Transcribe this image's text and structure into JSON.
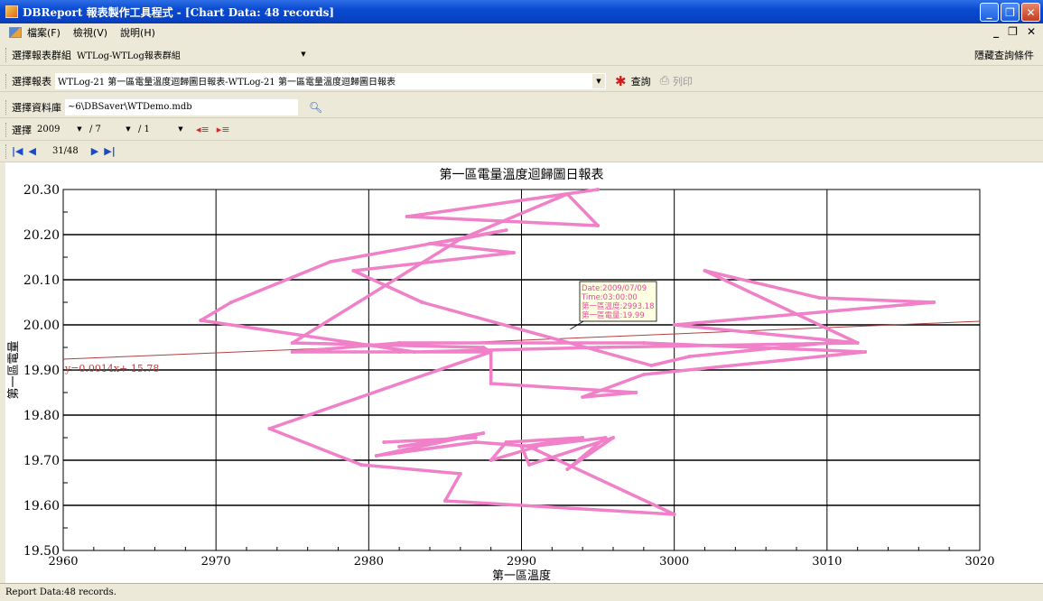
{
  "window": {
    "title": "DBReport 報表製作工具程式 - [Chart Data: 48 records]"
  },
  "menu": {
    "items": [
      "檔案(F)",
      "檢視(V)",
      "說明(H)"
    ]
  },
  "toolbar": {
    "group_label": "選擇報表群組",
    "group_value": "WTLog-WTLog報表群組",
    "hide_query": "隱藏查詢條件",
    "report_label": "選擇報表",
    "report_value": "WTLog-21 第一區電量溫度迴歸圖日報表-WTLog-21 第一區電量溫度迴歸圖日報表",
    "query_label": "查詢",
    "print_label": "列印",
    "db_label": "選擇資料庫",
    "db_value": "~6\\DBSaver\\WTDemo.mdb",
    "select_label": "選擇",
    "year": "2009",
    "month": "/ 7",
    "day": "/ 1",
    "page_indicator": "31/48"
  },
  "status": {
    "text": "Report Data:48 records."
  },
  "chart_data": {
    "type": "scatter",
    "title": "第一區電量溫度迴歸圖日報表",
    "xlabel": "第一區溫度",
    "ylabel": "第一區電量",
    "xlim": [
      2960,
      3020
    ],
    "ylim": [
      19.5,
      20.3
    ],
    "x_ticks": [
      "2960",
      "2970",
      "2980",
      "2990",
      "3000",
      "3010",
      "3020"
    ],
    "y_ticks": [
      "19.50",
      "19.60",
      "19.70",
      "19.80",
      "19.90",
      "20.00",
      "20.10",
      "20.20",
      "20.30"
    ],
    "grid": true,
    "series": [
      {
        "color": "#f080c8",
        "points": [
          [
            2995,
            20.3
          ],
          [
            2982.5,
            20.24
          ],
          [
            2995,
            20.22
          ],
          [
            2993,
            20.29
          ],
          [
            2986,
            20.19
          ],
          [
            2989,
            20.21
          ],
          [
            2977.5,
            20.14
          ],
          [
            2971,
            20.05
          ],
          [
            2969,
            20.01
          ],
          [
            2983,
            19.94
          ],
          [
            2995,
            19.95
          ],
          [
            3012,
            19.96
          ],
          [
            3002,
            20.12
          ],
          [
            3009.5,
            20.06
          ],
          [
            3017,
            20.05
          ],
          [
            3000,
            20.0
          ],
          [
            3012,
            19.96
          ],
          [
            3010,
            19.96
          ],
          [
            3001,
            19.93
          ],
          [
            2998.5,
            19.91
          ],
          [
            2983.5,
            20.05
          ],
          [
            2979,
            20.12
          ],
          [
            2989.5,
            20.16
          ],
          [
            2984,
            20.18
          ],
          [
            2986,
            20.19
          ],
          [
            2975,
            19.96
          ],
          [
            2987.5,
            19.95
          ],
          [
            2988,
            19.94
          ],
          [
            2982,
            19.94
          ],
          [
            2975,
            19.94
          ],
          [
            2982,
            19.96
          ],
          [
            2998,
            19.96
          ],
          [
            3012.5,
            19.94
          ],
          [
            2998,
            19.89
          ],
          [
            2994,
            19.84
          ],
          [
            2997.5,
            19.85
          ],
          [
            2988,
            19.87
          ],
          [
            2988,
            19.94
          ],
          [
            2973.5,
            19.77
          ],
          [
            2979.5,
            19.69
          ],
          [
            2986,
            19.67
          ],
          [
            2985,
            19.61
          ],
          [
            3000,
            19.58
          ],
          [
            2990.5,
            19.73
          ],
          [
            2995.5,
            19.75
          ],
          [
            2993,
            19.68
          ],
          [
            2996,
            19.75
          ],
          [
            2990.5,
            19.69
          ],
          [
            2990,
            19.73
          ],
          [
            2994,
            19.75
          ],
          [
            2989,
            19.74
          ],
          [
            2988,
            19.7
          ],
          [
            2991,
            19.73
          ],
          [
            2987,
            19.74
          ],
          [
            2980.5,
            19.71
          ],
          [
            2987.5,
            19.76
          ],
          [
            2982,
            19.73
          ],
          [
            2986,
            19.75
          ],
          [
            2987,
            19.75
          ],
          [
            2981,
            19.74
          ]
        ]
      }
    ],
    "trendline": {
      "color": "#b04040",
      "slope": 0.0014,
      "intercept": 15.78,
      "label": "y=0.0014x+ 15.78"
    },
    "annotation": {
      "x": 2993.18,
      "y": 19.99,
      "lines": [
        "Date:2009/07/09",
        "Time:03:00:00",
        "第一區溫度:2993.18",
        "第一區電量:19.99"
      ]
    }
  }
}
